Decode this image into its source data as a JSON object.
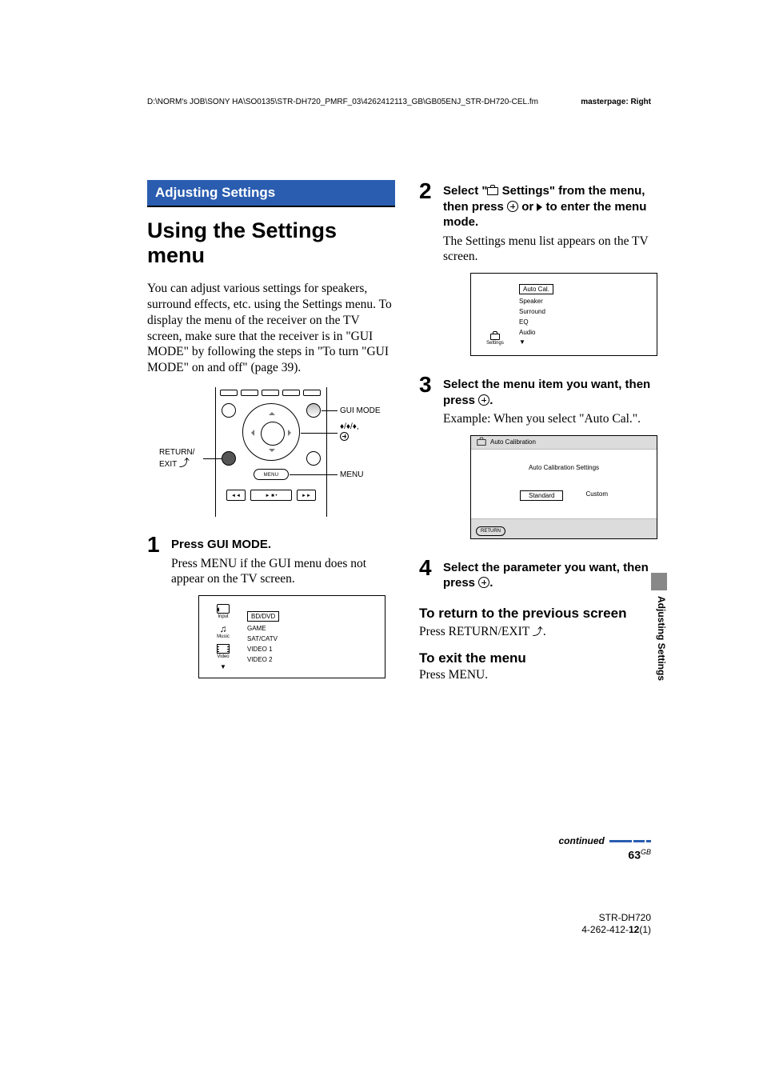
{
  "header": {
    "path": "D:\\NORM's JOB\\SONY HA\\SO0135\\STR-DH720_PMRF_03\\4262412113_GB\\GB05ENJ_STR-DH720-CEL.fm",
    "masterpage": "masterpage: Right"
  },
  "section_banner": "Adjusting Settings",
  "page_title": "Using the Settings menu",
  "intro_text": "You can adjust various settings for speakers, surround effects, etc. using the Settings menu. To display the menu of the receiver on the TV screen, make sure that the receiver is in \"GUI MODE\" by following the steps in \"To turn \"GUI MODE\" on and off\" (page 39).",
  "remote_callouts": {
    "return_exit": "RETURN/\nEXIT",
    "gui_mode": "GUI MODE",
    "dpad": " / / ,",
    "menu": "MENU",
    "menu_key_label": "MENU"
  },
  "steps": {
    "s1": {
      "num": "1",
      "title": "Press GUI MODE.",
      "desc": "Press MENU if the GUI menu does not appear on the TV screen."
    },
    "s2": {
      "num": "2",
      "title_before": "Select \"",
      "title_after": " Settings\" from the menu, then press ",
      "title_tail": " to enter the menu mode.",
      "or": " or ",
      "desc": "The Settings menu list appears on the TV screen."
    },
    "s3": {
      "num": "3",
      "title": "Select the menu item you want, then press ",
      "title_period": ".",
      "desc": "Example: When you select \"Auto Cal.\"."
    },
    "s4": {
      "num": "4",
      "title": "Select the parameter you want, then press ",
      "title_period": "."
    }
  },
  "gui_screens": {
    "menu1": {
      "sidebar": [
        {
          "icon": "input",
          "label": "Input"
        },
        {
          "icon": "music",
          "label": "Music"
        },
        {
          "icon": "video",
          "label": "Video"
        }
      ],
      "items": [
        "BD/DVD",
        "GAME",
        "SAT/CATV",
        "VIDEO 1",
        "VIDEO 2"
      ]
    },
    "menu2": {
      "sidebar_label": "Settings",
      "items": [
        "Auto Cal.",
        "Speaker",
        "Surround",
        "EQ",
        "Audio"
      ]
    },
    "autocal": {
      "title": "Auto Calibration",
      "heading": "Auto Calibration Settings",
      "options": {
        "standard": "Standard",
        "custom": "Custom"
      },
      "return": "RETURN"
    }
  },
  "sub_sections": {
    "return_prev": {
      "title": "To return to the previous screen",
      "body_before": "Press RETURN/EXIT ",
      "body_after": "."
    },
    "exit_menu": {
      "title": "To exit the menu",
      "body": "Press MENU."
    }
  },
  "side_tab": "Adjusting Settings",
  "continued_label": "continued",
  "page_number": {
    "num": "63",
    "suffix": "GB"
  },
  "footer_meta": {
    "model": "STR-DH720",
    "doc_before": "4-262-412-",
    "doc_bold": "12",
    "doc_after": "(1)"
  }
}
